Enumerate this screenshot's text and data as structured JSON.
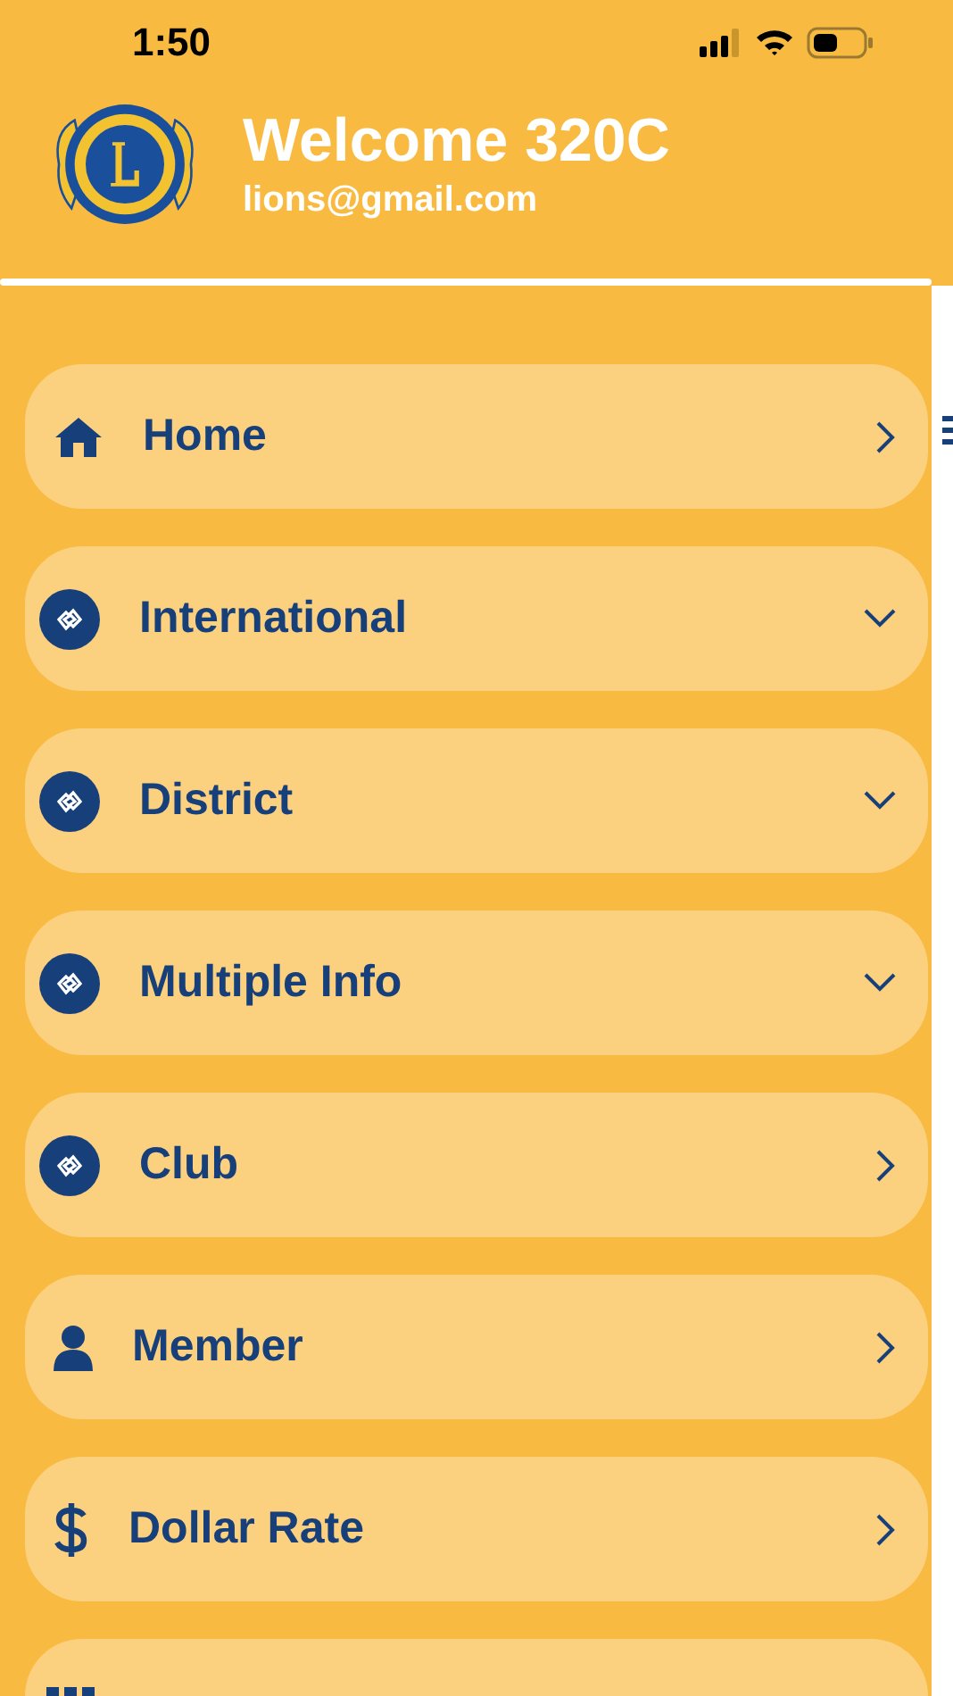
{
  "status_bar": {
    "time": "1:50"
  },
  "header": {
    "title": "Welcome 320C",
    "email": "lions@gmail.com"
  },
  "menu": [
    {
      "kind": "home",
      "label": "Home",
      "expandable": false
    },
    {
      "kind": "emblem",
      "label": "International",
      "expandable": true
    },
    {
      "kind": "emblem",
      "label": "District",
      "expandable": true
    },
    {
      "kind": "emblem",
      "label": "Multiple Info",
      "expandable": true
    },
    {
      "kind": "emblem",
      "label": "Club",
      "expandable": false
    },
    {
      "kind": "member",
      "label": "Member",
      "expandable": false
    },
    {
      "kind": "dollar",
      "label": "Dollar Rate",
      "expandable": false
    },
    {
      "kind": "grid"
    }
  ]
}
